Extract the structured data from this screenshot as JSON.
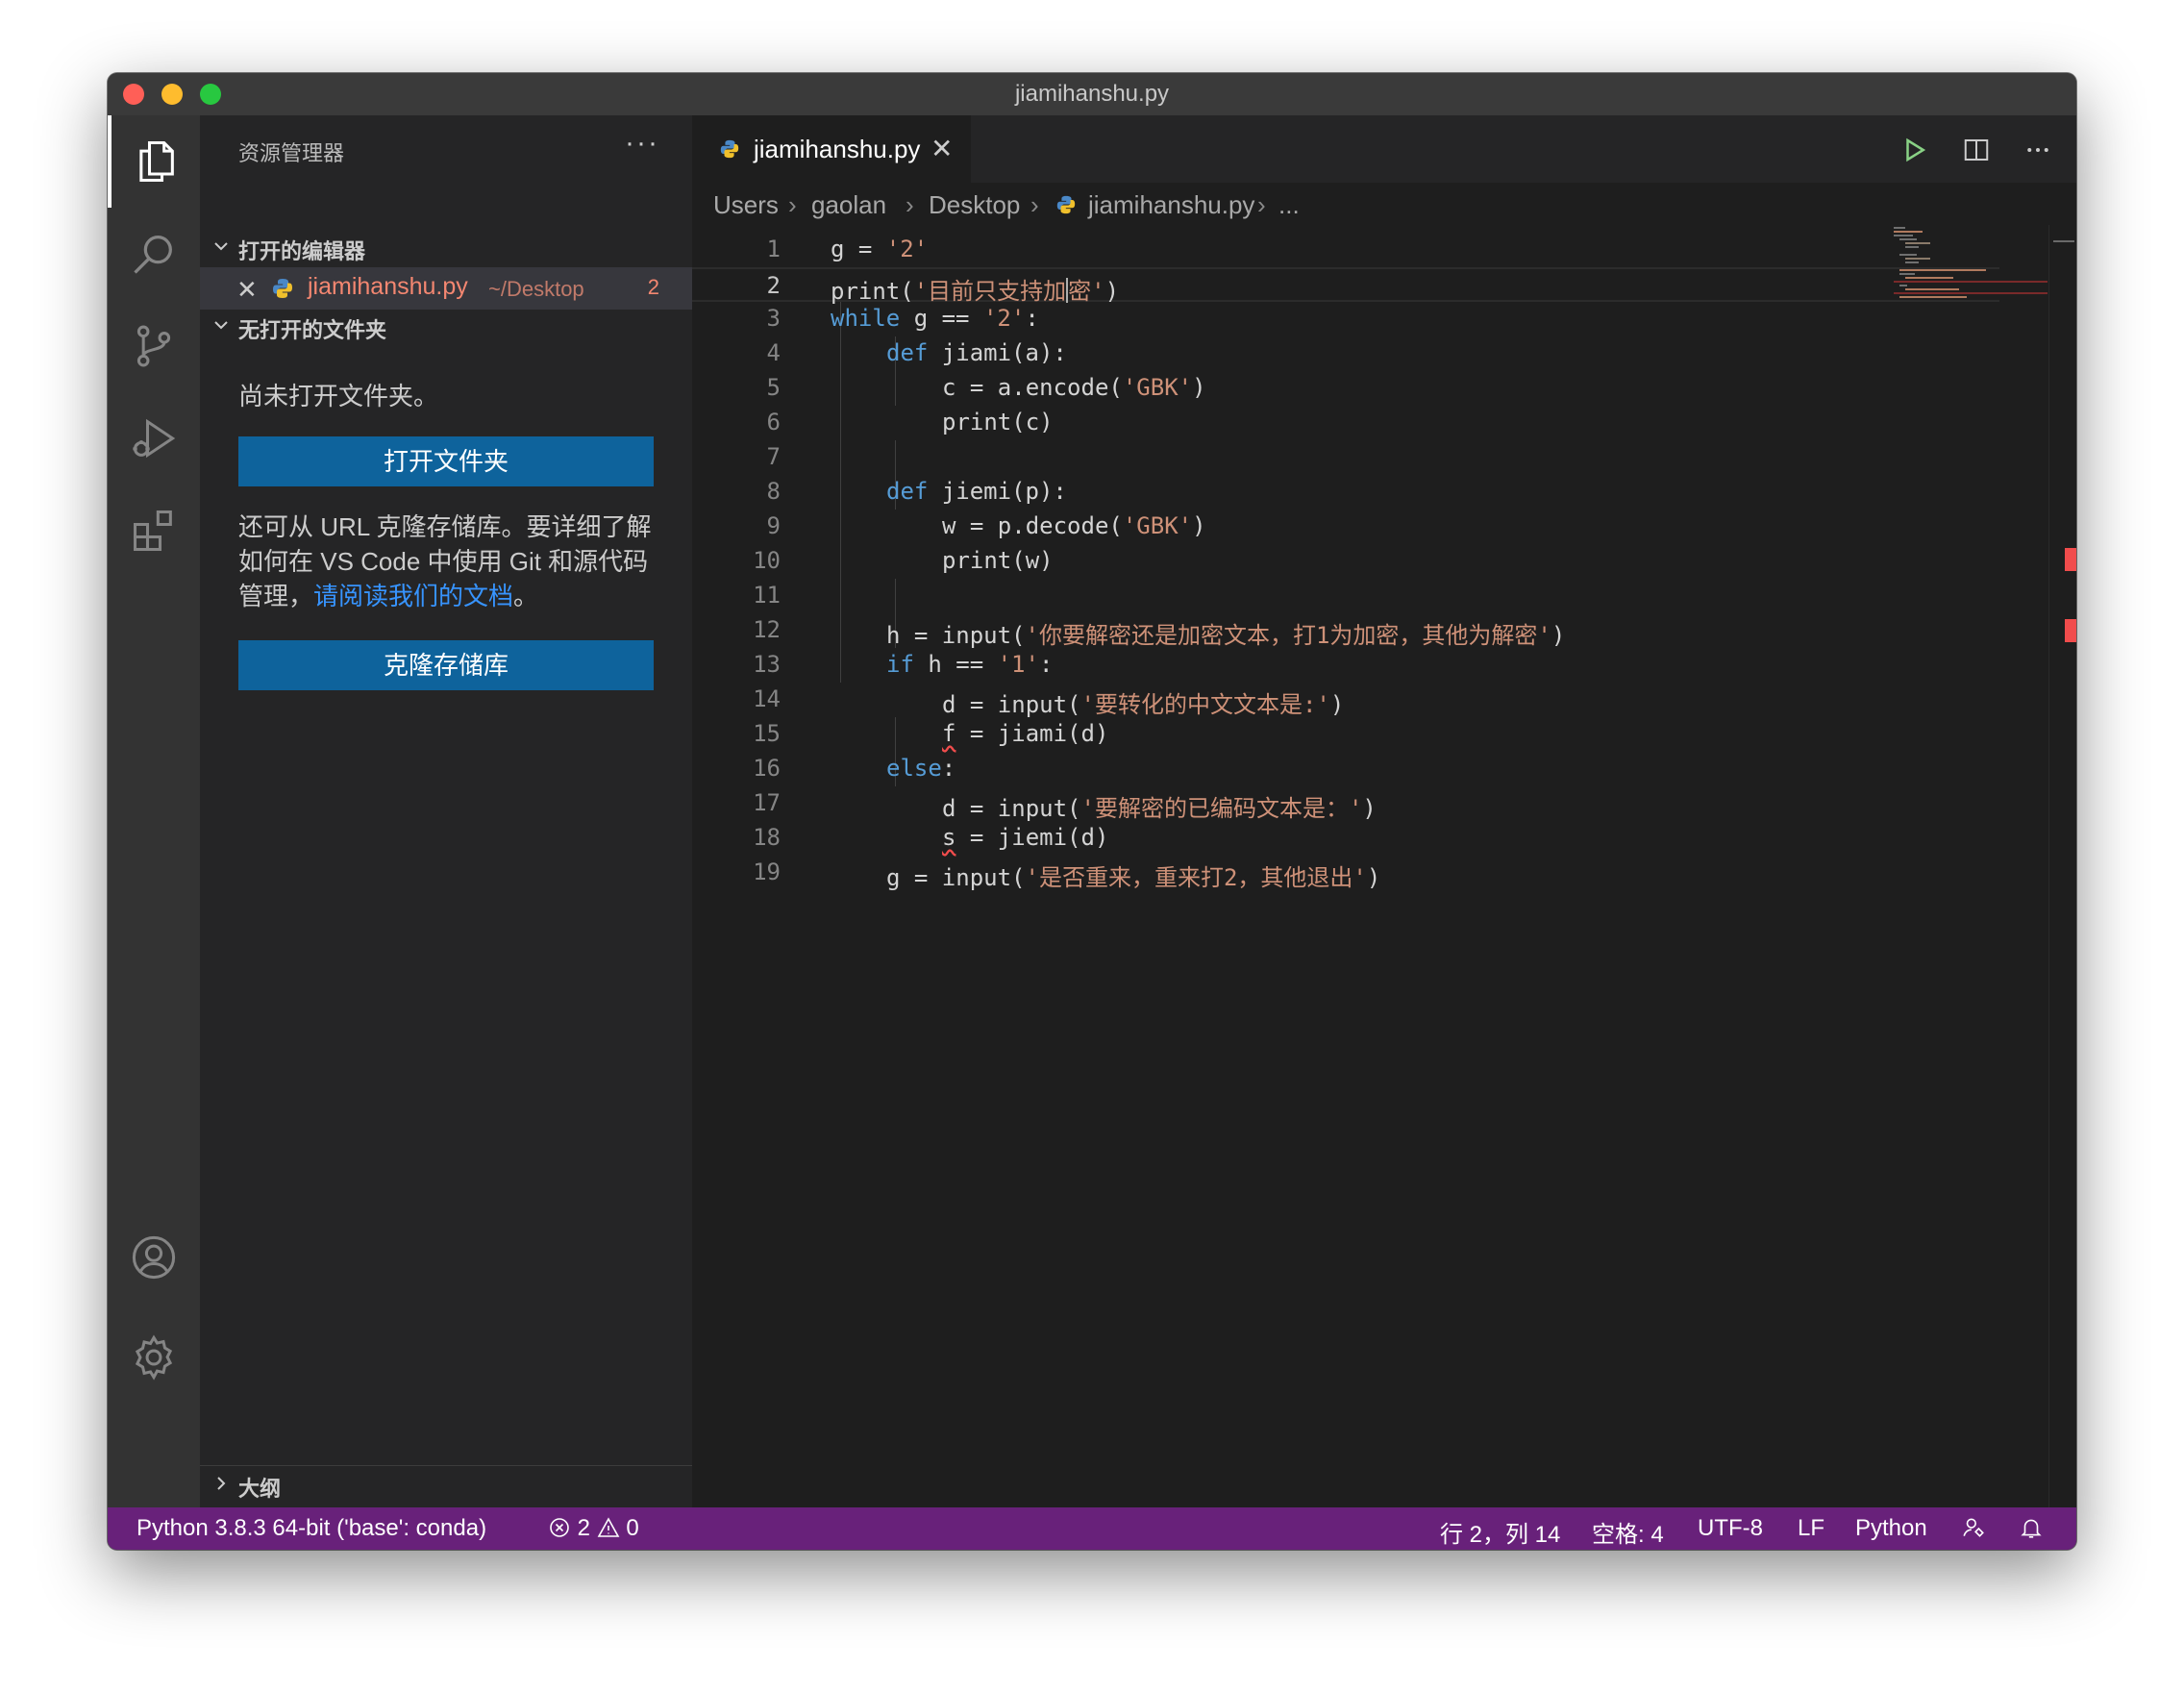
{
  "window": {
    "title": "jiamihanshu.py"
  },
  "activity_bar": {
    "items": [
      "explorer-icon",
      "search-icon",
      "source-control-icon",
      "run-debug-icon",
      "extensions-icon",
      "account-icon",
      "settings-gear-icon"
    ]
  },
  "sidebar": {
    "title": "资源管理器",
    "more": "···",
    "open_editors": {
      "header": "打开的编辑器",
      "file": {
        "close": "✕",
        "name": "jiamihanshu.py",
        "path": "~/Desktop",
        "problems": "2"
      }
    },
    "no_folder": {
      "header": "无打开的文件夹",
      "message": "尚未打开文件夹。",
      "open_button": "打开文件夹",
      "clone_text_1": "还可从 URL 克隆存储库。要详细了解",
      "clone_text_2": "如何在 VS Code 中使用 Git 和源代码",
      "clone_text_3": "管理，",
      "clone_link": "请阅读我们的文档",
      "clone_text_end": "。",
      "clone_button": "克隆存储库"
    },
    "outline": {
      "header": "大纲"
    }
  },
  "editor": {
    "tab": {
      "name": "jiamihanshu.py",
      "close": "✕"
    },
    "actions": [
      "run-icon",
      "split-editor-icon",
      "more-actions-icon"
    ],
    "breadcrumb": [
      "Users",
      "gaolan",
      "Desktop",
      "jiamihanshu.py",
      "..."
    ],
    "line_numbers": [
      "1",
      "2",
      "3",
      "4",
      "5",
      "6",
      "7",
      "8",
      "9",
      "10",
      "11",
      "12",
      "13",
      "14",
      "15",
      "16",
      "17",
      "18",
      "19"
    ],
    "code": {
      "l1a": "g = ",
      "l1s": "'2'",
      "l2a": "print(",
      "l2s1": "'目前只支持加",
      "l2s2": "密'",
      "l2b": ")",
      "l3k": "while",
      "l3a": " g == ",
      "l3s": "'2'",
      "l3b": ":",
      "l4k": "def",
      "l4a": " jiami(a):",
      "l5a": "c = a.encode(",
      "l5s": "'GBK'",
      "l5b": ")",
      "l6a": "print(c)",
      "l8k": "def",
      "l8a": " jiemi(p):",
      "l9a": "w = p.decode(",
      "l9s": "'GBK'",
      "l9b": ")",
      "l10a": "print(w)",
      "l12a": "h = input(",
      "l12s": "'你要解密还是加密文本，打1为加密，其他为解密'",
      "l12b": ")",
      "l13k": "if",
      "l13a": " h == ",
      "l13s": "'1'",
      "l13b": ":",
      "l14a": "d = input(",
      "l14s": "'要转化的中文文本是:'",
      "l14b": ")",
      "l15v": "f",
      "l15a": " = jiami(d)",
      "l16k": "else",
      "l16b": ":",
      "l17a": "d = input(",
      "l17s": "'要解密的已编码文本是：'",
      "l17b": ")",
      "l18v": "s",
      "l18a": " = jiemi(d)",
      "l19a": "g = input(",
      "l19s": "'是否重来，重来打2，其他退出'",
      "l19b": ")"
    }
  },
  "status_bar": {
    "interpreter": "Python 3.8.3 64-bit ('base': conda)",
    "errors": "2",
    "warnings": "0",
    "cursor": "行 2，列 14",
    "spaces": "空格: 4",
    "encoding": "UTF-8",
    "eol": "LF",
    "language": "Python",
    "bg_color": "#68217a"
  }
}
